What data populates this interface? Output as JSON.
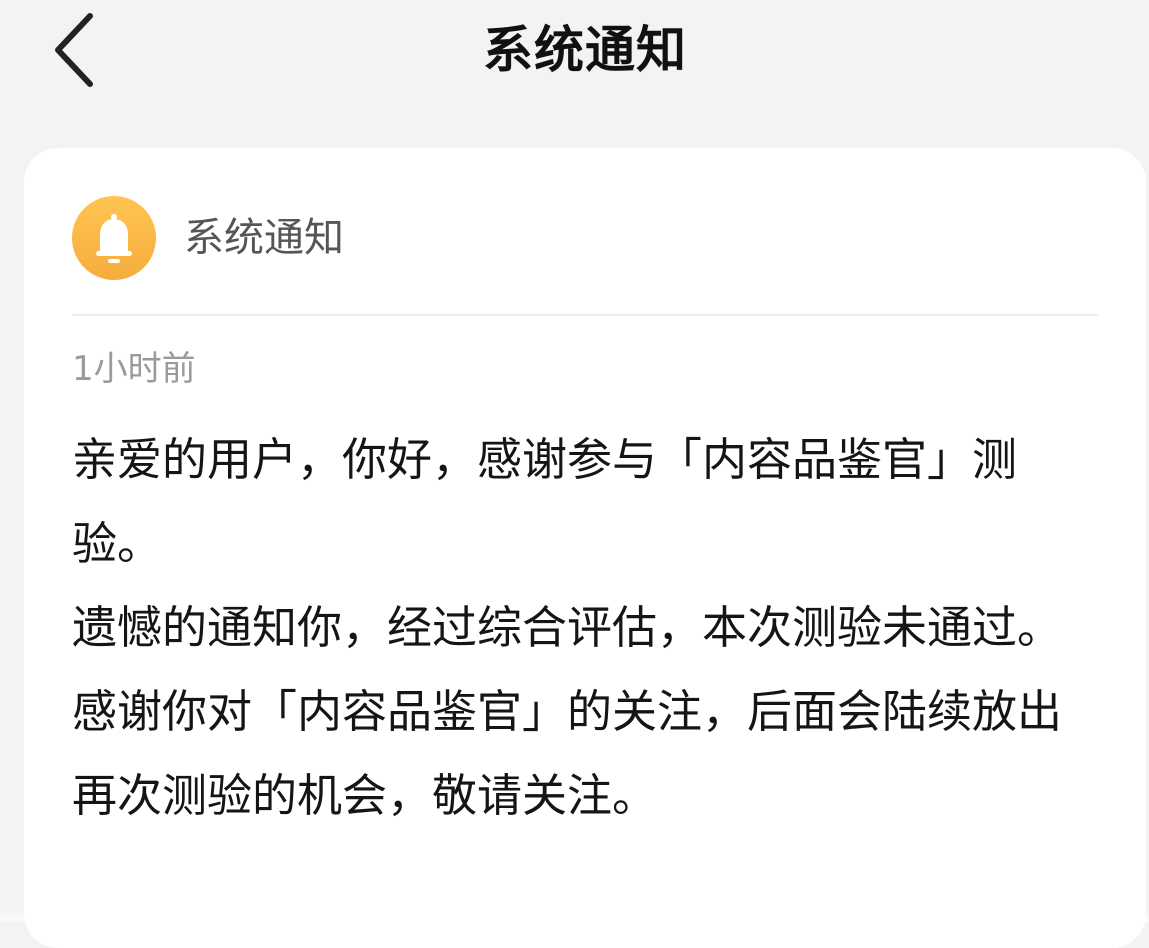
{
  "header": {
    "title": "系统通知",
    "back_icon": "chevron-left-icon"
  },
  "notification": {
    "sender": "系统通知",
    "avatar_icon": "bell-icon",
    "avatar_color": "#f7b440",
    "time": "1小时前",
    "message": "亲爱的用户，你好，感谢参与「内容品鉴官」测验。\n遗憾的通知你，经过综合评估，本次测验未通过。感谢你对「内容品鉴官」的关注，后面会陆续放出再次测验的机会，敬请关注。"
  },
  "colors": {
    "background": "#f2f3f5",
    "card": "#ffffff",
    "title_text": "#111111",
    "secondary_text": "#9a9a9a"
  }
}
